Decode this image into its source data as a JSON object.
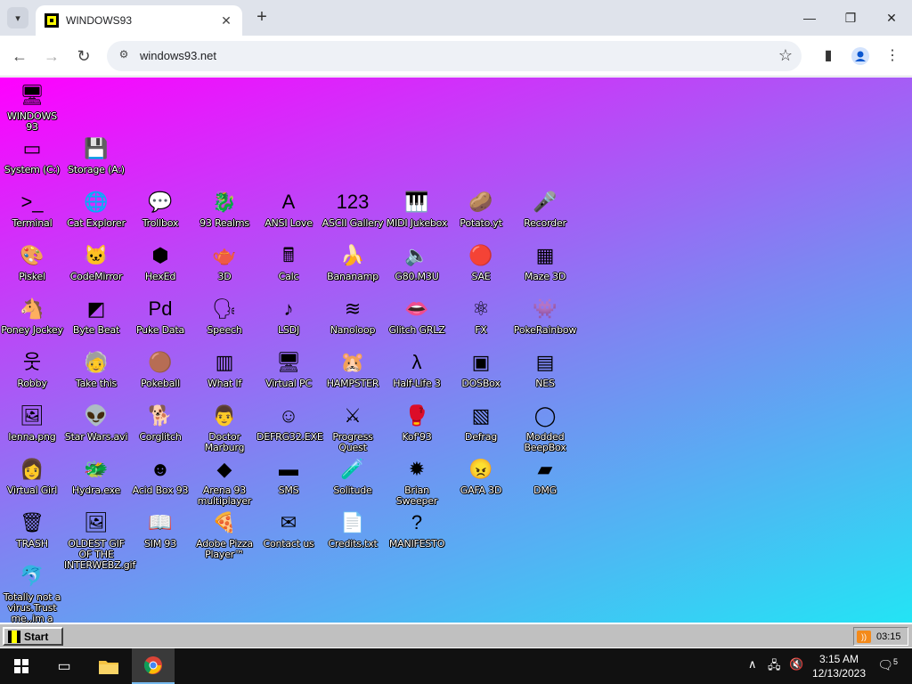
{
  "browser": {
    "tab_title": "WINDOWS93",
    "url": "windows93.net",
    "tab_search_glyph": "▾",
    "new_tab_glyph": "+",
    "close_glyph": "✕",
    "min_glyph": "—",
    "max_glyph": "❐",
    "back_glyph": "←",
    "forward_glyph": "→",
    "reload_glyph": "↻",
    "star_glyph": "☆"
  },
  "desktop_icons": [
    {
      "label": "WINDOWS 93",
      "icon": "computer-icon",
      "glyph": "🖥"
    },
    {
      "label": "System (C:)",
      "icon": "drive-icon",
      "glyph": "▭"
    },
    {
      "label": "Storage (A:)",
      "icon": "floppy-drive-icon",
      "glyph": "💾"
    },
    {
      "label": "Terminal",
      "icon": "terminal-icon",
      "glyph": ">_"
    },
    {
      "label": "Cat Explorer",
      "icon": "globe-icon",
      "glyph": "🌐"
    },
    {
      "label": "Trollbox",
      "icon": "chat-icon",
      "glyph": "💬"
    },
    {
      "label": "93 Realms",
      "icon": "realms-icon",
      "glyph": "🐉"
    },
    {
      "label": "ANSI Love",
      "icon": "ansi-icon",
      "glyph": "A"
    },
    {
      "label": "ASCII Gallery",
      "icon": "ascii-icon",
      "glyph": "123"
    },
    {
      "label": "MIDI Jukebox",
      "icon": "piano-icon",
      "glyph": "🎹"
    },
    {
      "label": "Potato.yt",
      "icon": "potato-icon",
      "glyph": "🥔"
    },
    {
      "label": "Recorder",
      "icon": "microphone-icon",
      "glyph": "🎤"
    },
    {
      "label": "Piskel",
      "icon": "palette-icon",
      "glyph": "🎨"
    },
    {
      "label": "CodeMirror",
      "icon": "codemirror-icon",
      "glyph": "🐱"
    },
    {
      "label": "HexEd",
      "icon": "cube-icon",
      "glyph": "⬢"
    },
    {
      "label": "3D",
      "icon": "teapot-icon",
      "glyph": "🫖"
    },
    {
      "label": "Calc",
      "icon": "calculator-icon",
      "glyph": "🖩"
    },
    {
      "label": "Bananamp",
      "icon": "banana-icon",
      "glyph": "🍌"
    },
    {
      "label": "G80.M3U",
      "icon": "audio-file-icon",
      "glyph": "🔈"
    },
    {
      "label": "SAE",
      "icon": "ball-icon",
      "glyph": "🔴"
    },
    {
      "label": "Maze 3D",
      "icon": "maze-icon",
      "glyph": "▦"
    },
    {
      "label": "Poney Jockey",
      "icon": "pony-icon",
      "glyph": "🐴"
    },
    {
      "label": "Byte Beat",
      "icon": "bytebeat-icon",
      "glyph": "◩"
    },
    {
      "label": "Puke Data",
      "icon": "puredata-icon",
      "glyph": "Pd"
    },
    {
      "label": "Speech",
      "icon": "speech-icon",
      "glyph": "🗣"
    },
    {
      "label": "LSDJ",
      "icon": "lsdj-icon",
      "glyph": "♪"
    },
    {
      "label": "Nanoloop",
      "icon": "waveform-icon",
      "glyph": "≋"
    },
    {
      "label": "Glitch GRLZ",
      "icon": "lips-icon",
      "glyph": "👄"
    },
    {
      "label": "FX",
      "icon": "atom-icon",
      "glyph": "⚛"
    },
    {
      "label": "PokeRainbow",
      "icon": "pokerainbow-icon",
      "glyph": "👾"
    },
    {
      "label": "Robby",
      "icon": "stickman-icon",
      "glyph": "웃"
    },
    {
      "label": "Take this",
      "icon": "takethis-icon",
      "glyph": "🧓"
    },
    {
      "label": "Pokeball",
      "icon": "pokeball-icon",
      "glyph": "🟤"
    },
    {
      "label": "What If",
      "icon": "whatif-icon",
      "glyph": "▥"
    },
    {
      "label": "Virtual PC",
      "icon": "virtualpc-icon",
      "glyph": "🖥"
    },
    {
      "label": "HAMPSTER",
      "icon": "hamster-icon",
      "glyph": "🐹"
    },
    {
      "label": "Half-Life 3",
      "icon": "halflife-icon",
      "glyph": "λ"
    },
    {
      "label": "DOSBox",
      "icon": "dosbox-icon",
      "glyph": "▣"
    },
    {
      "label": "NES",
      "icon": "nes-icon",
      "glyph": "▤"
    },
    {
      "label": "lenna.png",
      "icon": "image-file-icon",
      "glyph": "🖼"
    },
    {
      "label": "Star Wars.avi",
      "icon": "yoda-icon",
      "glyph": "👽"
    },
    {
      "label": "Corglitch",
      "icon": "corgi-icon",
      "glyph": "🐕"
    },
    {
      "label": "Doctor Marburg",
      "icon": "doctor-icon",
      "glyph": "👨"
    },
    {
      "label": "DEFRG32.EXE",
      "icon": "defrag-exe-icon",
      "glyph": "☺"
    },
    {
      "label": "Progress Quest",
      "icon": "swords-icon",
      "glyph": "⚔"
    },
    {
      "label": "Kof'93",
      "icon": "fighter-icon",
      "glyph": "🥊"
    },
    {
      "label": "Defrag",
      "icon": "defrag-icon",
      "glyph": "▧"
    },
    {
      "label": "Modded BeepBox",
      "icon": "beepbox-icon",
      "glyph": "◯"
    },
    {
      "label": "Virtual Girl",
      "icon": "virtualgirl-icon",
      "glyph": "👩"
    },
    {
      "label": "Hydra.exe",
      "icon": "hydra-icon",
      "glyph": "🐲"
    },
    {
      "label": "Acid Box 93",
      "icon": "smiley-icon",
      "glyph": "☻"
    },
    {
      "label": "Arena 93 multiplayer",
      "icon": "arena-cube-icon",
      "glyph": "◆"
    },
    {
      "label": "SMS",
      "icon": "sms-console-icon",
      "glyph": "▬"
    },
    {
      "label": "Solitude",
      "icon": "solitude-icon",
      "glyph": "🧪"
    },
    {
      "label": "Brian Sweeper",
      "icon": "mine-icon",
      "glyph": "✹"
    },
    {
      "label": "GAFA 3D",
      "icon": "gafa-icon",
      "glyph": "😠"
    },
    {
      "label": "DMG",
      "icon": "gameboy-icon",
      "glyph": "▰"
    },
    {
      "label": "TRASH",
      "icon": "trash-icon",
      "glyph": "🗑"
    },
    {
      "label": "OLDEST GIF OF THE INTERWEBZ.gif",
      "icon": "gif-file-icon",
      "glyph": "🖼"
    },
    {
      "label": "SIM 93",
      "icon": "book-icon",
      "glyph": "📖"
    },
    {
      "label": "Adobe Pizza Player™",
      "icon": "pizza-icon",
      "glyph": "🍕"
    },
    {
      "label": "Contact us",
      "icon": "contact-icon",
      "glyph": "✉"
    },
    {
      "label": "Credits.txt",
      "icon": "text-file-icon",
      "glyph": "📄"
    },
    {
      "label": "MANIFESTO",
      "icon": "question-icon",
      "glyph": "?"
    },
    {
      "label": "Totally not a virus.Trust me..im a",
      "icon": "dolphin-icon",
      "glyph": "🐬"
    }
  ],
  "w93_taskbar": {
    "start_label": "Start",
    "clock": "03:15"
  },
  "windows_taskbar": {
    "time": "3:15 AM",
    "date": "12/13/2023",
    "notification_count": "5"
  }
}
